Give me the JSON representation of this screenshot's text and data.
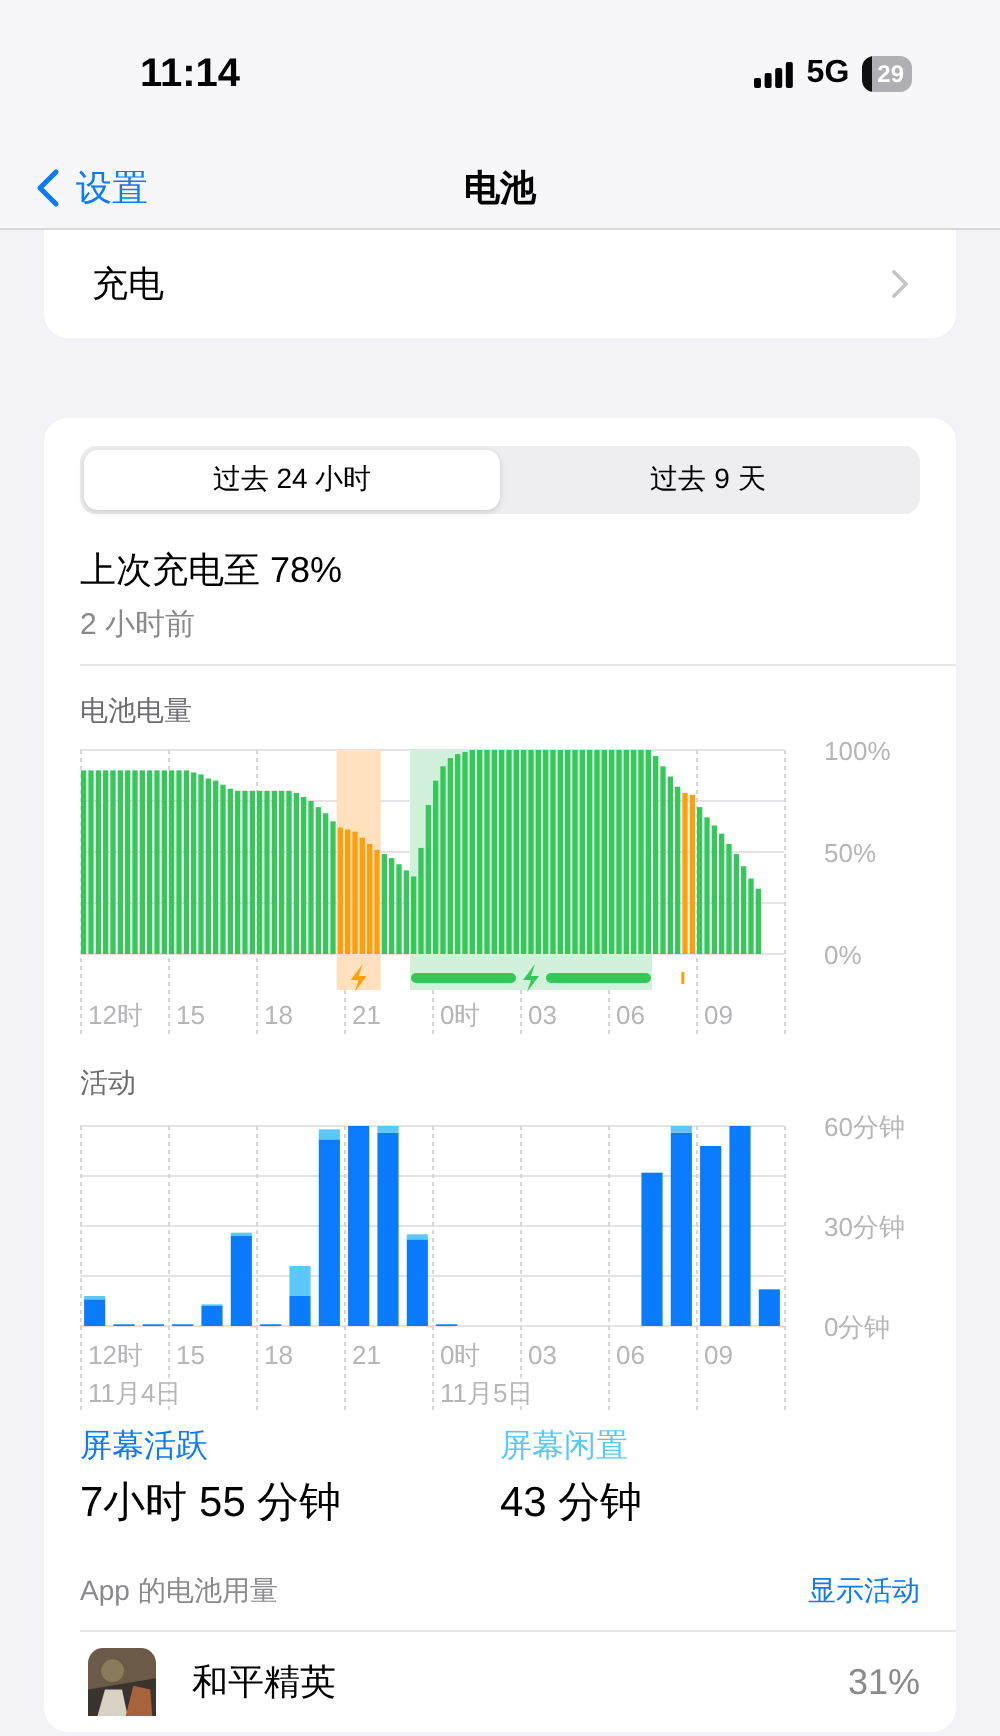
{
  "status_bar": {
    "time": "11:14",
    "network": "5G",
    "battery": "29"
  },
  "nav": {
    "back": "设置",
    "title": "电池"
  },
  "charging_row": {
    "label": "充电"
  },
  "tabs": [
    {
      "label": "过去 24 小时",
      "selected": true
    },
    {
      "label": "过去 9 天",
      "selected": false
    }
  ],
  "last_charge": {
    "title": "上次充电至 78%",
    "time": "2 小时前"
  },
  "battery_chart": {
    "x_labels": [
      "12时",
      "15",
      "18",
      "21",
      "0时",
      "03",
      "06",
      "09"
    ],
    "chart_data": {
      "type": "bar",
      "title": "电池电量",
      "stacked": true,
      "ylim": [
        0,
        100
      ],
      "yticks": [
        {
          "value": 0,
          "label": "0%"
        },
        {
          "value": 50,
          "label": "50%"
        },
        {
          "value": 100,
          "label": "100%"
        }
      ],
      "series": [
        {
          "color": "#34c759",
          "values": [
            90,
            90,
            90,
            90,
            90,
            90,
            90,
            90,
            90,
            90,
            90,
            90,
            90,
            90,
            90,
            89,
            88,
            86,
            85,
            83,
            81,
            80,
            80,
            80,
            80,
            80,
            80,
            80,
            80,
            79,
            77,
            75,
            72,
            69,
            65,
            null,
            null,
            null,
            null,
            null,
            null,
            49,
            47,
            44,
            41,
            38,
            52,
            73,
            85,
            92,
            96,
            98,
            99,
            100,
            100,
            100,
            100,
            100,
            100,
            100,
            100,
            100,
            100,
            100,
            100,
            100,
            100,
            100,
            100,
            100,
            100,
            100,
            100,
            100,
            100,
            100,
            100,
            100,
            97,
            92,
            87,
            82,
            null,
            null,
            72,
            67,
            63,
            59,
            54,
            49,
            43,
            37,
            32
          ]
        },
        {
          "color": "#ff9f0a",
          "values": [
            null,
            null,
            null,
            null,
            null,
            null,
            null,
            null,
            null,
            null,
            null,
            null,
            null,
            null,
            null,
            null,
            null,
            null,
            null,
            null,
            null,
            null,
            null,
            null,
            null,
            null,
            null,
            null,
            null,
            null,
            null,
            null,
            null,
            null,
            null,
            62,
            61,
            60,
            57,
            54,
            51,
            null,
            null,
            null,
            null,
            null,
            null,
            null,
            null,
            null,
            null,
            null,
            null,
            null,
            null,
            null,
            null,
            null,
            null,
            null,
            null,
            null,
            null,
            null,
            null,
            null,
            null,
            null,
            null,
            null,
            null,
            null,
            null,
            null,
            null,
            null,
            null,
            null,
            null,
            null,
            null,
            null,
            79,
            78,
            null,
            null,
            null,
            null,
            null,
            null,
            null,
            null,
            null
          ]
        }
      ]
    }
  },
  "activity_chart": {
    "x_labels": [
      "12时",
      "15",
      "18",
      "21",
      "0时",
      "03",
      "06",
      "09"
    ],
    "dates": [
      "11月4日",
      "11月5日"
    ],
    "chart_data": {
      "type": "bar",
      "title": "活动",
      "stacked": true,
      "ylim": [
        0,
        60
      ],
      "yticks": [
        {
          "value": 0,
          "label": "0分钟"
        },
        {
          "value": 30,
          "label": "30分钟"
        },
        {
          "value": 60,
          "label": "60分钟"
        }
      ],
      "series": [
        {
          "color": "#0a7aff",
          "values": [
            8,
            0.5,
            0.5,
            0.5,
            6,
            27,
            0.5,
            9,
            56,
            60,
            58,
            26,
            0.5,
            0,
            0,
            0,
            0,
            0,
            0,
            46,
            58,
            54,
            60,
            11
          ]
        },
        {
          "color": "#5ac8fa",
          "values": [
            1,
            0,
            0,
            0,
            0.5,
            1,
            0,
            9,
            3,
            0,
            2,
            1.5,
            0,
            0,
            0,
            0,
            0,
            0,
            0,
            0,
            2,
            0,
            0,
            0
          ]
        }
      ]
    }
  },
  "stats": [
    {
      "label": "屏幕活跃",
      "value": "7小时 55 分钟",
      "color": "#0a7aff"
    },
    {
      "label": "屏幕闲置",
      "value": "43 分钟",
      "color": "#5ac8fa"
    }
  ],
  "app_usage": {
    "title": "App 的电池用量",
    "link": "显示活动",
    "apps": [
      {
        "name": "和平精英",
        "percent": "31%"
      }
    ]
  }
}
